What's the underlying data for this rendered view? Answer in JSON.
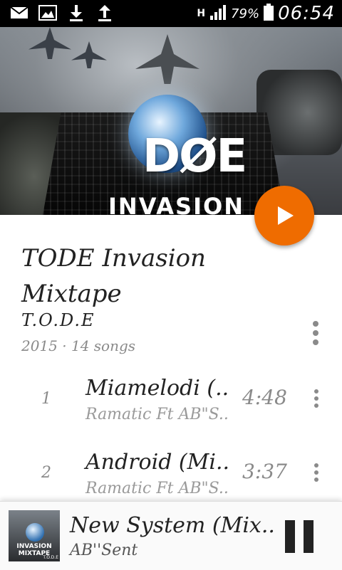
{
  "status_bar": {
    "icons": [
      "mail-icon",
      "image-icon",
      "download-icon",
      "upload-icon"
    ],
    "network": "H",
    "battery_percent": "79%",
    "time": "06:54"
  },
  "album": {
    "art_logo": "DØE",
    "art_caption": "INVASION",
    "title": "TODE Invasion Mixtape",
    "artist": "T.O.D.E",
    "meta": "2015 · 14 songs"
  },
  "tracks": [
    {
      "number": "1",
      "title": "Miamelodi (..",
      "artist": "Ramatic Ft AB\"S..",
      "duration": "4:48"
    },
    {
      "number": "2",
      "title": "Android (Mi..",
      "artist": "Ramatic Ft AB\"S..",
      "duration": "3:37"
    }
  ],
  "now_playing": {
    "thumb_caption": "INVASION MIXTAPE",
    "thumb_artist": "T.O.D.E",
    "title": "New System (Mix..",
    "artist": "AB''Sent"
  },
  "colors": {
    "accent": "#ef6c00",
    "status_bar": "#000000",
    "text_primary": "#222222",
    "text_secondary": "#8a8a8a"
  }
}
